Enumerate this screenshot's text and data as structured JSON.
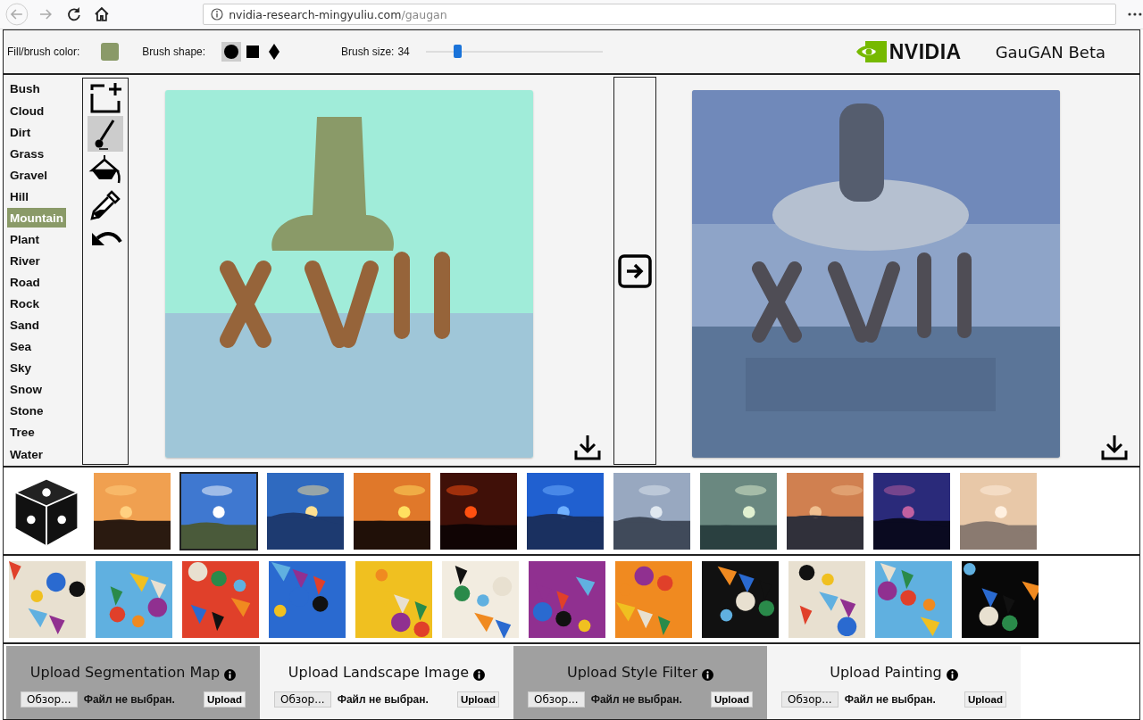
{
  "browser": {
    "url_host": "nvidia-research-mingyuliu.com",
    "url_path": "/gaugan"
  },
  "toolbar": {
    "fill_label": "Fill/brush color:",
    "shape_label": "Brush shape:",
    "shapes": [
      {
        "kind": "circle",
        "selected": true
      },
      {
        "kind": "square",
        "selected": false
      },
      {
        "kind": "diamond",
        "selected": false
      }
    ],
    "size_label": "Brush size:",
    "size_value": "34",
    "level": 0.18
  },
  "brand": {
    "name": "NVIDIA",
    "title": "GauGAN Beta"
  },
  "labels": [
    {
      "label": "Bush",
      "selected": false
    },
    {
      "label": "Cloud",
      "selected": false
    },
    {
      "label": "Dirt",
      "selected": false
    },
    {
      "label": "Grass",
      "selected": false
    },
    {
      "label": "Gravel",
      "selected": false
    },
    {
      "label": "Hill",
      "selected": false
    },
    {
      "label": "Mountain",
      "selected": true
    },
    {
      "label": "Plant",
      "selected": false
    },
    {
      "label": "River",
      "selected": false
    },
    {
      "label": "Road",
      "selected": false
    },
    {
      "label": "Rock",
      "selected": false
    },
    {
      "label": "Sand",
      "selected": false
    },
    {
      "label": "Sea",
      "selected": false
    },
    {
      "label": "Sky",
      "selected": false
    },
    {
      "label": "Snow",
      "selected": false
    },
    {
      "label": "Stone",
      "selected": false
    },
    {
      "label": "Tree",
      "selected": false
    },
    {
      "label": "Water",
      "selected": false
    }
  ],
  "tools": [
    {
      "kind": "new",
      "selected": false
    },
    {
      "kind": "brush",
      "selected": true
    },
    {
      "kind": "fill",
      "selected": false
    },
    {
      "kind": "picker",
      "selected": false
    },
    {
      "kind": "undo",
      "selected": false
    }
  ],
  "landscapes": [
    {
      "kind": "random",
      "selected": false
    },
    {
      "kind": "picture",
      "selected": false
    },
    {
      "kind": "picture",
      "selected": true
    },
    {
      "kind": "picture",
      "selected": false
    },
    {
      "kind": "picture",
      "selected": false
    },
    {
      "kind": "picture",
      "selected": false
    },
    {
      "kind": "picture",
      "selected": false
    },
    {
      "kind": "picture",
      "selected": false
    },
    {
      "kind": "picture",
      "selected": false
    },
    {
      "kind": "picture",
      "selected": false
    },
    {
      "kind": "picture",
      "selected": false
    },
    {
      "kind": "picture",
      "selected": false
    }
  ],
  "paintings": [
    {
      "kind": "picture",
      "selected": false
    },
    {
      "kind": "picture",
      "selected": false
    },
    {
      "kind": "picture",
      "selected": false
    },
    {
      "kind": "picture",
      "selected": false
    },
    {
      "kind": "picture",
      "selected": false
    },
    {
      "kind": "picture",
      "selected": false
    },
    {
      "kind": "picture",
      "selected": false
    },
    {
      "kind": "picture",
      "selected": false
    },
    {
      "kind": "picture",
      "selected": false
    },
    {
      "kind": "picture",
      "selected": false
    },
    {
      "kind": "picture",
      "selected": false
    },
    {
      "kind": "picture",
      "selected": false
    }
  ],
  "uploads": [
    {
      "title": "Upload Segmentation Map",
      "browse": "Обзор...",
      "file_status": "Файл не выбран.",
      "button": "Upload",
      "shaded": true
    },
    {
      "title": "Upload Landscape Image",
      "browse": "Обзор...",
      "file_status": "Файл не выбран.",
      "button": "Upload",
      "shaded": false
    },
    {
      "title": "Upload Style Filter",
      "browse": "Обзор...",
      "file_status": "Файл не выбран.",
      "button": "Upload",
      "shaded": true
    },
    {
      "title": "Upload Painting",
      "browse": "Обзор...",
      "file_status": "Файл не выбран.",
      "button": "Upload",
      "shaded": false
    }
  ]
}
